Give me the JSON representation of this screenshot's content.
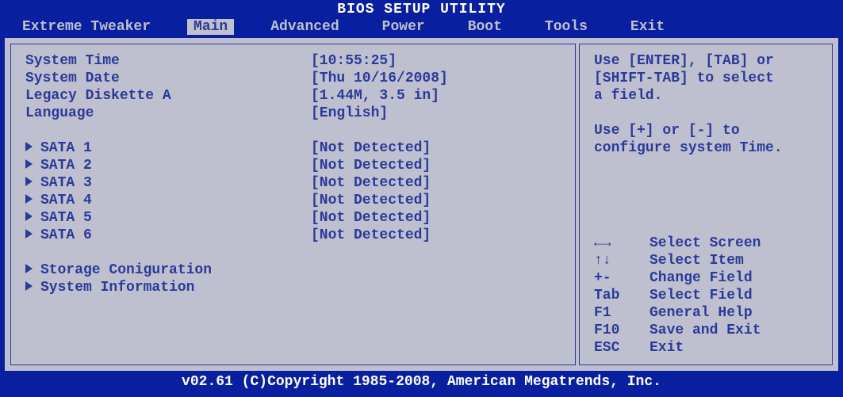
{
  "title": "BIOS SETUP UTILITY",
  "tabs": [
    {
      "label": "Extreme Tweaker",
      "active": false
    },
    {
      "label": "Main",
      "active": true
    },
    {
      "label": "Advanced",
      "active": false
    },
    {
      "label": "Power",
      "active": false
    },
    {
      "label": "Boot",
      "active": false
    },
    {
      "label": "Tools",
      "active": false
    },
    {
      "label": "Exit",
      "active": false
    }
  ],
  "main": {
    "rows": [
      {
        "label": "System Time",
        "value": "[10:55:25]"
      },
      {
        "label": "System Date",
        "value": "[Thu 10/16/2008]"
      },
      {
        "label": "Legacy Diskette A",
        "value": "[1.44M, 3.5 in]"
      },
      {
        "label": "Language",
        "value": "[English]"
      }
    ],
    "sata": [
      {
        "label": "SATA 1",
        "value": "[Not Detected]"
      },
      {
        "label": "SATA 2",
        "value": "[Not Detected]"
      },
      {
        "label": "SATA 3",
        "value": "[Not Detected]"
      },
      {
        "label": "SATA 4",
        "value": "[Not Detected]"
      },
      {
        "label": "SATA 5",
        "value": "[Not Detected]"
      },
      {
        "label": "SATA 6",
        "value": "[Not Detected]"
      }
    ],
    "submenus": [
      {
        "label": "Storage Coniguration"
      },
      {
        "label": "System Information"
      }
    ]
  },
  "help": {
    "line1": "Use [ENTER], [TAB] or",
    "line2": "[SHIFT-TAB] to select",
    "line3": "a field.",
    "line4": "Use [+] or [-] to",
    "line5": "configure system Time."
  },
  "keys": [
    {
      "key": "←→",
      "desc": "Select Screen"
    },
    {
      "key": "↑↓",
      "desc": "Select Item"
    },
    {
      "key": "+-",
      "desc": "Change Field"
    },
    {
      "key": "Tab",
      "desc": "Select Field"
    },
    {
      "key": "F1",
      "desc": "General Help"
    },
    {
      "key": "F10",
      "desc": "Save and Exit"
    },
    {
      "key": "ESC",
      "desc": "Exit"
    }
  ],
  "footer": "v02.61 (C)Copyright 1985-2008, American Megatrends, Inc."
}
